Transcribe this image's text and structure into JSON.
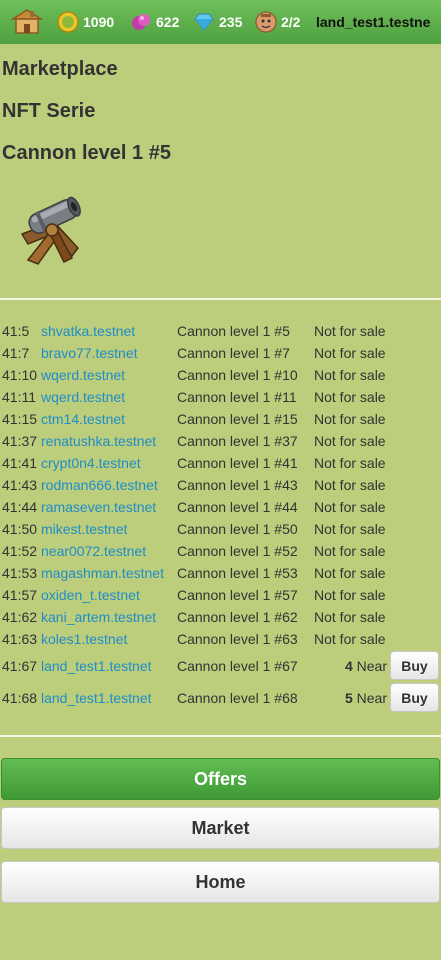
{
  "topbar": {
    "home_icon": "house-icon",
    "coins": "1090",
    "gems_pink": "622",
    "diamonds": "235",
    "workers": "2/2",
    "account": "land_test1.testne"
  },
  "headings": {
    "section": "Marketplace",
    "serie": "NFT Serie",
    "item": "Cannon level 1 #5"
  },
  "listings": [
    {
      "id": "41:5",
      "owner": "shvatka.testnet",
      "name": "Cannon level 1 #5",
      "status": "Not for sale"
    },
    {
      "id": "41:7",
      "owner": "bravo77.testnet",
      "name": "Cannon level 1 #7",
      "status": "Not for sale"
    },
    {
      "id": "41:10",
      "owner": "wqerd.testnet",
      "name": "Cannon level 1 #10",
      "status": "Not for sale"
    },
    {
      "id": "41:11",
      "owner": "wqerd.testnet",
      "name": "Cannon level 1 #11",
      "status": "Not for sale"
    },
    {
      "id": "41:15",
      "owner": "ctm14.testnet",
      "name": "Cannon level 1 #15",
      "status": "Not for sale"
    },
    {
      "id": "41:37",
      "owner": "renatushka.testnet",
      "name": "Cannon level 1 #37",
      "status": "Not for sale"
    },
    {
      "id": "41:41",
      "owner": "crypt0n4.testnet",
      "name": "Cannon level 1 #41",
      "status": "Not for sale"
    },
    {
      "id": "41:43",
      "owner": "rodman666.testnet",
      "name": "Cannon level 1 #43",
      "status": "Not for sale"
    },
    {
      "id": "41:44",
      "owner": "ramaseven.testnet",
      "name": "Cannon level 1 #44",
      "status": "Not for sale"
    },
    {
      "id": "41:50",
      "owner": "mikest.testnet",
      "name": "Cannon level 1 #50",
      "status": "Not for sale"
    },
    {
      "id": "41:52",
      "owner": "near0072.testnet",
      "name": "Cannon level 1 #52",
      "status": "Not for sale"
    },
    {
      "id": "41:53",
      "owner": "magashman.testnet",
      "name": "Cannon level 1 #53",
      "status": "Not for sale"
    },
    {
      "id": "41:57",
      "owner": "oxiden_t.testnet",
      "name": "Cannon level 1 #57",
      "status": "Not for sale"
    },
    {
      "id": "41:62",
      "owner": "kani_artem.testnet",
      "name": "Cannon level 1 #62",
      "status": "Not for sale"
    },
    {
      "id": "41:63",
      "owner": "koles1.testnet",
      "name": "Cannon level 1 #63",
      "status": "Not for sale"
    }
  ],
  "for_sale": [
    {
      "id": "41:67",
      "owner": "land_test1.testnet",
      "name": "Cannon level 1 #67",
      "price": "4",
      "currency": "Near",
      "buy_label": "Buy"
    },
    {
      "id": "41:68",
      "owner": "land_test1.testnet",
      "name": "Cannon level 1 #68",
      "price": "5",
      "currency": "Near",
      "buy_label": "Buy"
    }
  ],
  "buttons": {
    "offers": "Offers",
    "market": "Market",
    "home": "Home"
  },
  "colors": {
    "background": "#bccd7b",
    "topbar": "#5bb049",
    "link": "#1f8ec8",
    "primary_button": "#4ea941"
  }
}
